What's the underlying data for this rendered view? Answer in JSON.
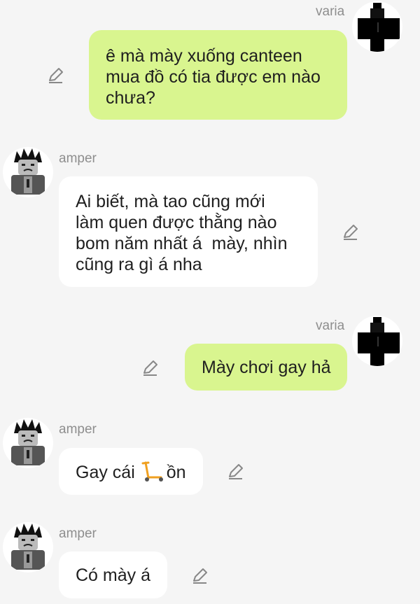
{
  "messages": [
    {
      "sender": "varia",
      "lines": [
        "ê mà mày xuống canteen",
        "mua đồ có tia được em nào",
        "chưa?"
      ]
    },
    {
      "sender": "amper",
      "lines": [
        "Ai biết, mà tao cũng mới",
        "làm quen được thằng nào",
        "bom năm nhất á  mày, nhìn",
        "cũng ra gì á nha"
      ]
    },
    {
      "sender": "varia",
      "lines": [
        "Mày chơi gay hả"
      ]
    },
    {
      "sender": "amper",
      "lines": [
        "Gay cái ",
        "ồn"
      ]
    },
    {
      "sender": "amper",
      "lines": [
        "Có mày á"
      ]
    }
  ],
  "icons": {
    "edit": "pencil-edit-icon",
    "scooter": "kick-scooter-emoji"
  },
  "colors": {
    "background": "#f5f5f5",
    "my_bubble": "#d9f58f",
    "their_bubble": "#ffffff",
    "name_text": "#8e8e8e",
    "scooter": "#f0a020"
  }
}
